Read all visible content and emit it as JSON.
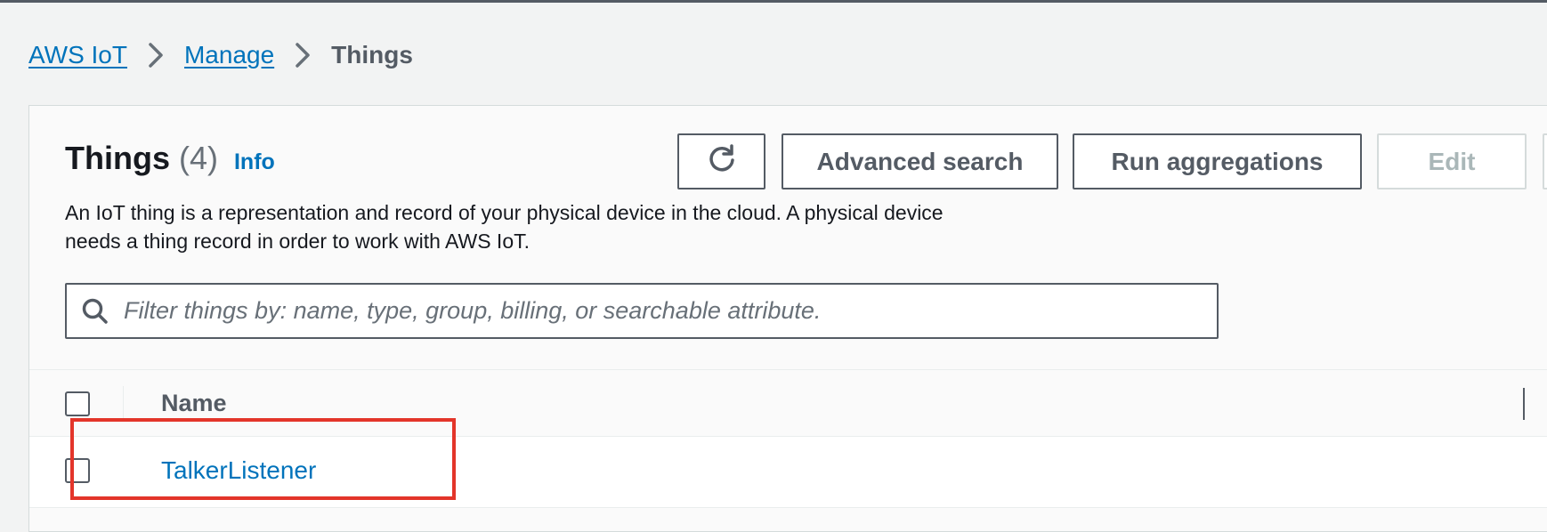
{
  "breadcrumb": {
    "items": [
      "AWS IoT",
      "Manage"
    ],
    "current": "Things"
  },
  "panel": {
    "title": "Things",
    "count": "(4)",
    "info_label": "Info",
    "description_line1": "An IoT thing is a representation and record of your physical device in the cloud. A physical device",
    "description_line2": "needs a thing record in order to work with AWS IoT."
  },
  "toolbar": {
    "refresh_icon": "refresh-icon",
    "advanced_search_label": "Advanced search",
    "run_aggregations_label": "Run aggregations",
    "edit_label": "Edit"
  },
  "search": {
    "icon": "search-icon",
    "placeholder": "Filter things by: name, type, group, billing, or searchable attribute."
  },
  "table": {
    "columns": [
      "Name"
    ],
    "rows": [
      {
        "name": "TalkerListener"
      }
    ]
  },
  "colors": {
    "link": "#0073bb",
    "highlight": "#e3352a",
    "background": "#f2f3f3"
  }
}
